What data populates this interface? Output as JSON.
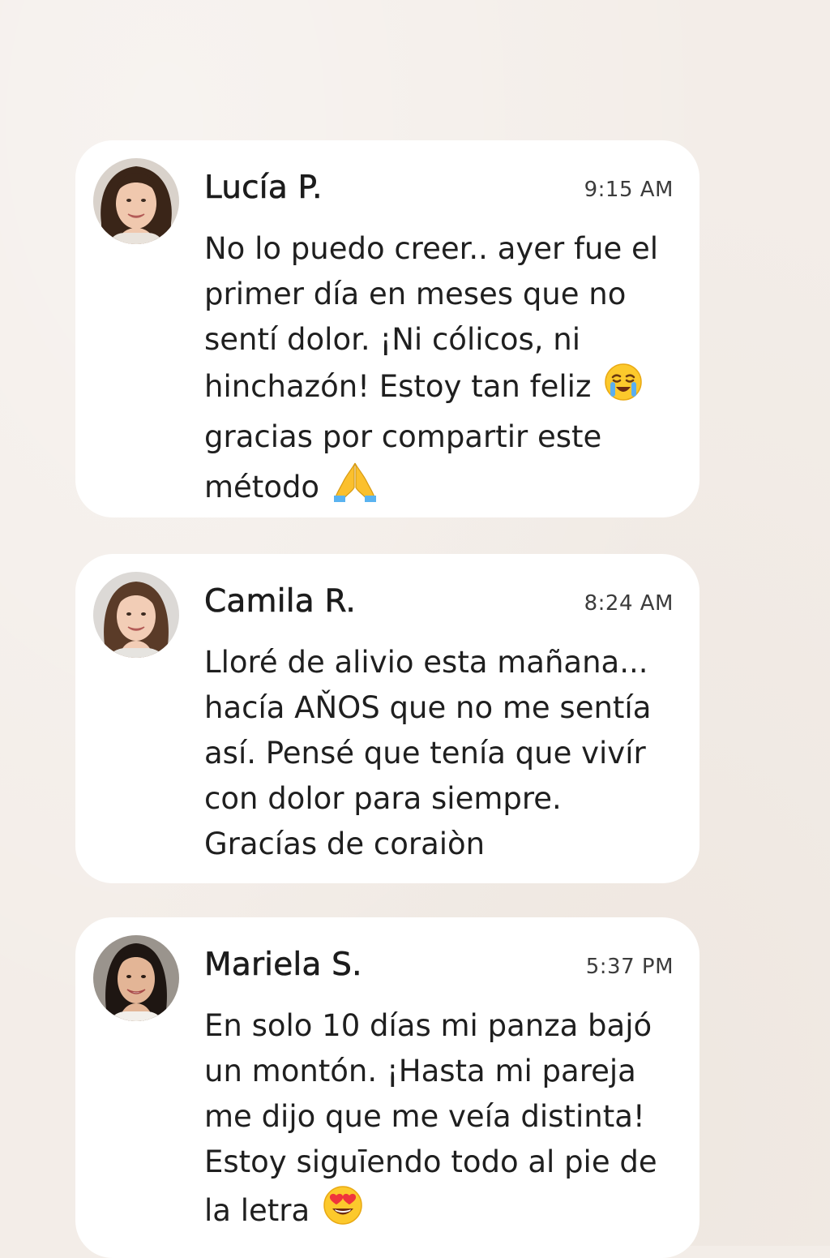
{
  "messages": [
    {
      "name": "Lucía P.",
      "time": "9:15 AM",
      "text": "No lo puedo creer.. ayer fue el primer día en meses que no sentí dolor. ¡Ni cólicos, ni hinchazón! Estoy tan feliz",
      "text2": "gracias por compartir este método",
      "emoji1": "crying-face-icon",
      "emoji2": "praying-hands-icon"
    },
    {
      "name": "Camila R.",
      "time": "8:24 AM",
      "text": "Lloré de alivio esta mañana... hacía AŇOS que no me sentía así. Pensé que tenía que vivír con dolor para siempre. Gracías de coraiòn"
    },
    {
      "name": "Mariela S.",
      "time": "5:37 PM",
      "text": "En solo 10 días mi panza bajó un montón. ¡Hasta mi pareja me dijo que me veía distinta! Estoy siguīendo todo al pie de la letra",
      "emoji1": "heart-eyes-icon"
    }
  ],
  "colors": {
    "background": "#f3ede8",
    "card": "#ffffff",
    "text": "#1f1f1f",
    "time": "#3c3c3c"
  }
}
